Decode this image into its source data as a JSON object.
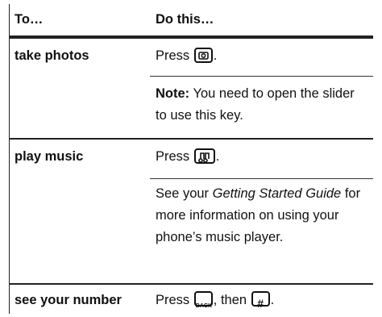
{
  "table": {
    "headers": [
      "To…",
      "Do this…"
    ],
    "rows": [
      {
        "task": "take photos",
        "steps": [
          {
            "pre": "Press",
            "key": "camera-key-icon",
            "post": "."
          },
          {
            "note_label": "Note:",
            "note_text": " You need to open the slider to use this key."
          }
        ]
      },
      {
        "task": "play music",
        "steps": [
          {
            "pre": "Press",
            "key": "music-key-icon",
            "post": "."
          },
          {
            "text_before": "See your ",
            "italic": "Getting Started Guide",
            "text_after": " for more information on using your phone’s music player."
          }
        ]
      },
      {
        "task": "see your number",
        "steps": [
          {
            "pre": "Press",
            "key": "back-key-icon",
            "key_label": "BACK",
            "mid": ", then",
            "key2": "hash-key-icon",
            "key2_label": "#",
            "post": "."
          }
        ]
      }
    ]
  }
}
